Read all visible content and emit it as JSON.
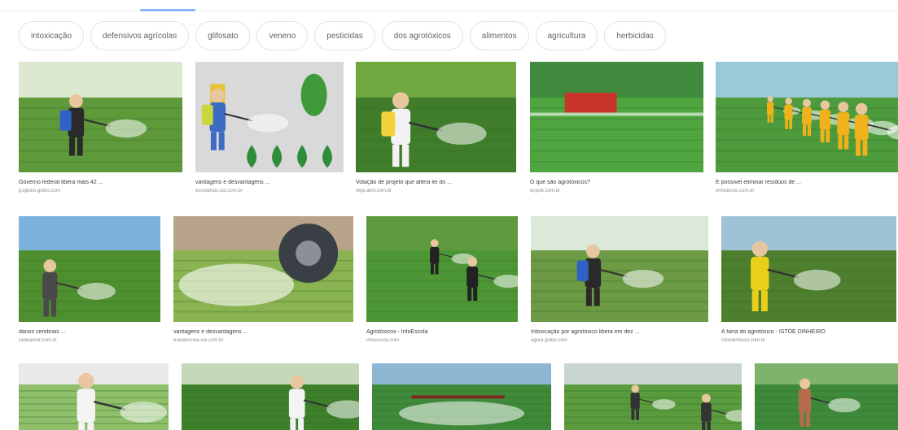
{
  "chips": [
    {
      "label": "intoxicação",
      "name": "chip-intoxicacao"
    },
    {
      "label": "defensivos agrícolas",
      "name": "chip-defensivos-agricolas"
    },
    {
      "label": "glifosato",
      "name": "chip-glifosato"
    },
    {
      "label": "veneno",
      "name": "chip-veneno"
    },
    {
      "label": "pesticidas",
      "name": "chip-pesticidas"
    },
    {
      "label": "dos agrotóxicos",
      "name": "chip-dos-agrotoxicos"
    },
    {
      "label": "alimentos",
      "name": "chip-alimentos"
    },
    {
      "label": "agricultura",
      "name": "chip-agricultura"
    },
    {
      "label": "herbicidas",
      "name": "chip-herbicidas"
    }
  ],
  "rows": [
    [
      {
        "title": "Governo federal libera mais 42 ...",
        "source": "g1globo.globo.com",
        "scene": "field-sprayer",
        "sky": "#dce8d0",
        "field": "#5f9a3a"
      },
      {
        "title": "vantagens e desvantagens ...",
        "source": "escolakids.uol.com.br",
        "scene": "illustration",
        "sky": "#d9d9d9",
        "field": "#d9d9d9"
      },
      {
        "title": "Votação de projeto que altera lei do ...",
        "source": "veja.abril.com.br",
        "scene": "hazmat-closeup",
        "sky": "#6ea83e",
        "field": "#3f7d2a"
      },
      {
        "title": "O que são agrotóxicos?",
        "source": "ecycle.com.br",
        "scene": "tractor",
        "sky": "#3f8a3c",
        "field": "#4fa640"
      },
      {
        "title": "É possível eliminar resíduos de ...",
        "source": "emedicine.com.br",
        "scene": "workers-yellow",
        "sky": "#9cc9d9",
        "field": "#4d9b3c"
      }
    ],
    [
      {
        "title": "danos cerebrais ...",
        "source": "radioamor.com.br",
        "scene": "worker-vineyard",
        "sky": "#7bb3dd",
        "field": "#4f8f2f"
      },
      {
        "title": "vantagens e desvantagens ...",
        "source": "brasilescola.uol.com.br",
        "scene": "tractor-spray",
        "sky": "#b8a48a",
        "field": "#8ab452"
      },
      {
        "title": "Agrotóxicos - InfoEscola",
        "source": "infoescola.com",
        "scene": "two-sprayers",
        "sky": "#5f9b3e",
        "field": "#4d9636"
      },
      {
        "title": "Intoxicação por agrotóxico libera em dez ...",
        "source": "agora.globo.com",
        "scene": "field-sprayer",
        "sky": "#dde9d8",
        "field": "#6c9a45"
      },
      {
        "title": "A farra do agrotóxico - ISTOÉ DINHEIRO",
        "source": "istoedinheiro.com.br",
        "scene": "sunset-yellow",
        "sky": "#9fc3d6",
        "field": "#4e7f2e"
      }
    ],
    [
      {
        "title": "",
        "source": "",
        "scene": "hazmat-portrait",
        "sky": "#e9e9e9",
        "field": "#8fbf6a"
      },
      {
        "title": "",
        "source": "",
        "scene": "white-suit",
        "sky": "#c5d9b9",
        "field": "#3d7f2b"
      },
      {
        "title": "",
        "source": "",
        "scene": "cropduster",
        "sky": "#8fb7d3",
        "field": "#3e8a3a"
      },
      {
        "title": "",
        "source": "",
        "scene": "rows-workers",
        "sky": "#c9d6cf",
        "field": "#5a9b3d"
      },
      {
        "title": "",
        "source": "",
        "scene": "lettuce-worker",
        "sky": "#7fb26a",
        "field": "#3e8a3a"
      }
    ]
  ]
}
